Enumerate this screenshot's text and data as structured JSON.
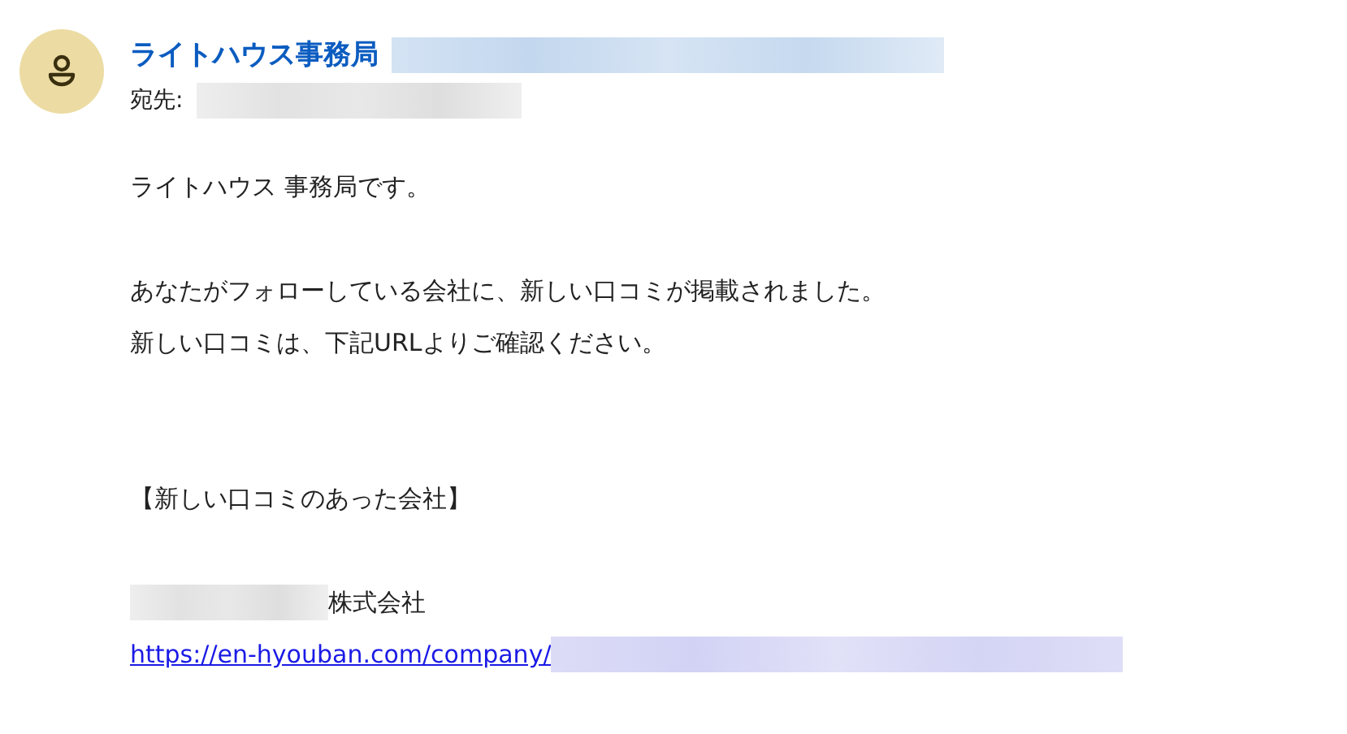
{
  "sender": {
    "name": "ライトハウス事務局"
  },
  "recipient": {
    "label": "宛先:"
  },
  "body": [
    {
      "kind": "text",
      "text": "ライトハウス 事務局です。"
    },
    {
      "kind": "blank"
    },
    {
      "kind": "text",
      "text": "あなたがフォローしている会社に、新しい口コミが掲載されました。"
    },
    {
      "kind": "text",
      "text": "新しい口コミは、下記URLよりご確認ください。"
    },
    {
      "kind": "blank"
    },
    {
      "kind": "blank"
    },
    {
      "kind": "text",
      "text": "【新しい口コミのあった会社】"
    },
    {
      "kind": "blank"
    },
    {
      "kind": "company",
      "text": "株式会社"
    },
    {
      "kind": "link",
      "text": "https://en-hyouban.com/company/"
    }
  ]
}
